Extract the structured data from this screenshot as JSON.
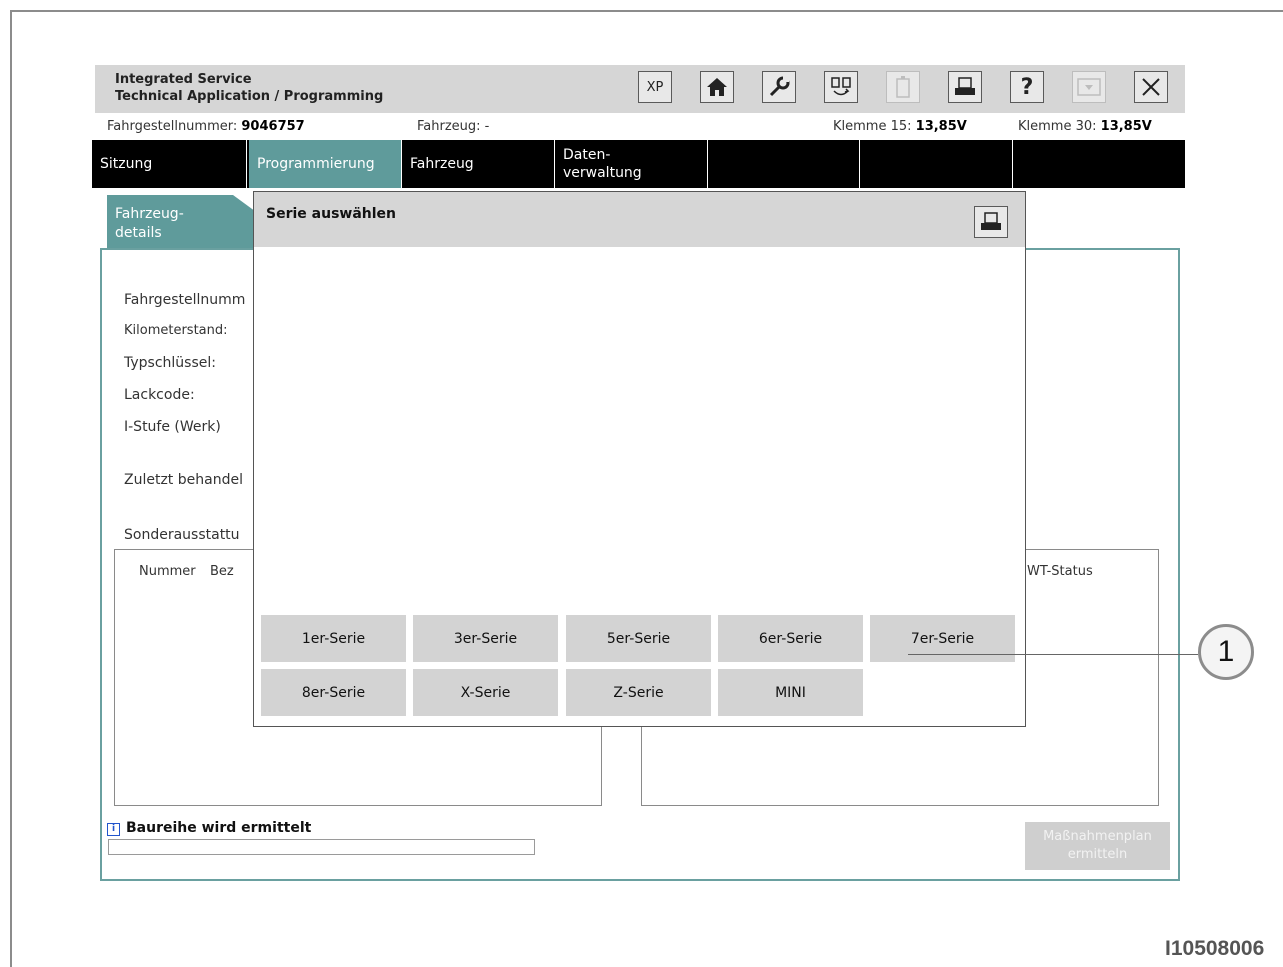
{
  "window": {
    "title_line1": "Integrated Service",
    "title_line2": "Technical Application / Programming",
    "toolbar": {
      "xp_label": "XP",
      "help_label": "?",
      "buttons": [
        "xp-icon",
        "home-icon",
        "wrench-icon",
        "connection-icon",
        "battery-icon",
        "print-icon",
        "help-icon",
        "minimize-icon",
        "close-icon"
      ]
    }
  },
  "status": {
    "vin_label": "Fahrgestellnummer:",
    "vin_value": "9046757",
    "vehicle_label": "Fahrzeug:",
    "vehicle_value": "-",
    "klemme15_label": "Klemme 15:",
    "klemme15_value": "13,85V",
    "klemme30_label": "Klemme 30:",
    "klemme30_value": "13,85V"
  },
  "menu": {
    "items": [
      {
        "label": "Sitzung"
      },
      {
        "label": "Programmierung"
      },
      {
        "label": "Fahrzeug"
      },
      {
        "label": "Daten-\nverwaltung"
      },
      {
        "label": ""
      },
      {
        "label": ""
      },
      {
        "label": ""
      }
    ],
    "active_index": 1
  },
  "details": {
    "tab_label": "Fahrzeug-\ndetails",
    "fields": [
      "Fahrgestellnumm",
      "Kilometerstand:",
      "Typschlüssel:",
      "Lackcode:",
      "I-Stufe (Werk)",
      "Zuletzt behandel",
      "Sonderausstattu"
    ],
    "table_left_headers": [
      "Nummer",
      "Bez"
    ],
    "table_right_header": "WT-Status"
  },
  "info": {
    "message": "Baureihe wird ermittelt",
    "progress": 0
  },
  "plan_button": "Maßnahmenplan\nermitteln",
  "dialog": {
    "title": "Serie auswählen",
    "series": [
      "1er-Serie",
      "3er-Serie",
      "5er-Serie",
      "6er-Serie",
      "7er-Serie",
      "8er-Serie",
      "X-Serie",
      "Z-Serie",
      "MINI"
    ]
  },
  "callout": "1",
  "figure_id": "I10508006",
  "colors": {
    "accent": "#5f9b9b",
    "menubar": "#000000",
    "titlebar": "#d6d6d6",
    "button": "#d3d3d3"
  }
}
